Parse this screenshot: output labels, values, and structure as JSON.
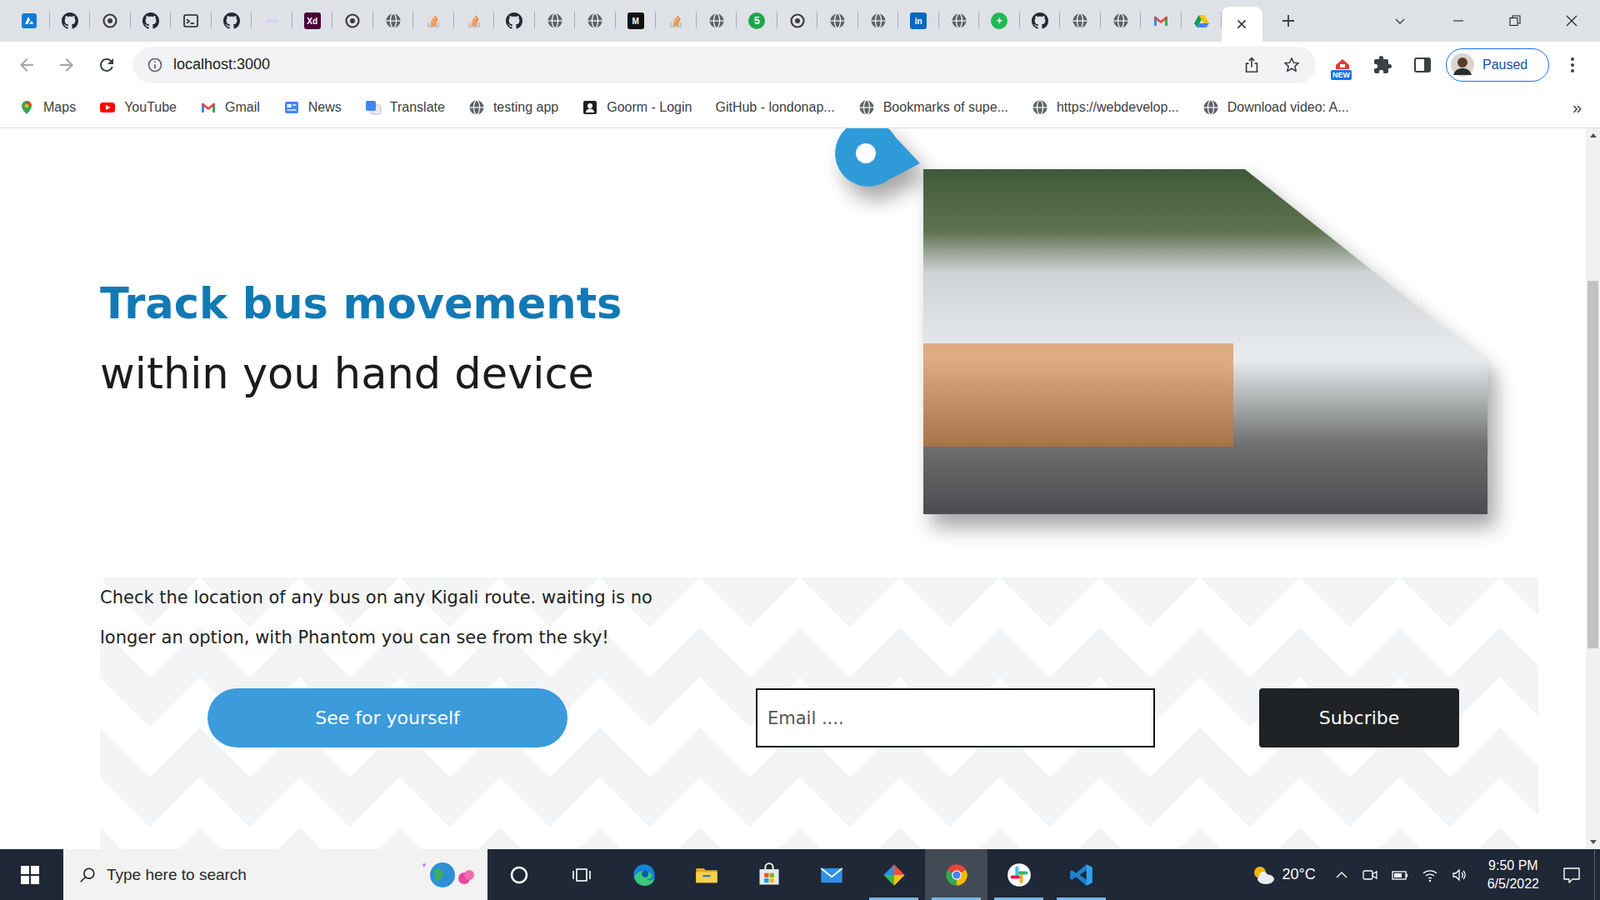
{
  "browser": {
    "tabs": [
      {
        "kind": "azure",
        "selected": false
      },
      {
        "kind": "github",
        "selected": false
      },
      {
        "kind": "chrome",
        "selected": false
      },
      {
        "kind": "github",
        "selected": false
      },
      {
        "kind": "terminal",
        "selected": false
      },
      {
        "kind": "github",
        "selected": false
      },
      {
        "kind": "faint",
        "selected": false
      },
      {
        "kind": "letter",
        "glyph": "Xd",
        "color": "#470137",
        "selected": false
      },
      {
        "kind": "chrome",
        "selected": false
      },
      {
        "kind": "globe",
        "selected": false
      },
      {
        "kind": "stack",
        "selected": false
      },
      {
        "kind": "stack",
        "selected": false
      },
      {
        "kind": "github",
        "selected": false
      },
      {
        "kind": "globe",
        "selected": false
      },
      {
        "kind": "globe",
        "selected": false
      },
      {
        "kind": "letter",
        "glyph": "M",
        "color": "#111111",
        "selected": false
      },
      {
        "kind": "stack",
        "selected": false
      },
      {
        "kind": "globe",
        "selected": false
      },
      {
        "kind": "dot",
        "glyph": "5",
        "color": "#1fa64a",
        "selected": false
      },
      {
        "kind": "chrome",
        "selected": false
      },
      {
        "kind": "globe",
        "selected": false
      },
      {
        "kind": "globe",
        "selected": false
      },
      {
        "kind": "letter",
        "glyph": "in",
        "color": "#0a66c2",
        "selected": false
      },
      {
        "kind": "globe",
        "selected": false
      },
      {
        "kind": "dot",
        "glyph": "+",
        "color": "#1db954",
        "selected": false
      },
      {
        "kind": "github",
        "selected": false
      },
      {
        "kind": "globe",
        "selected": false
      },
      {
        "kind": "globe",
        "selected": false
      },
      {
        "kind": "gmail",
        "selected": false
      },
      {
        "kind": "drive",
        "selected": false
      },
      {
        "kind": "blank",
        "selected": true
      }
    ],
    "address": "localhost:3000",
    "extension_badge": "NEW",
    "profile_status": "Paused",
    "bookmarks": [
      {
        "label": "Maps",
        "kind": "maps"
      },
      {
        "label": "YouTube",
        "kind": "youtube"
      },
      {
        "label": "Gmail",
        "kind": "gmail"
      },
      {
        "label": "News",
        "kind": "news"
      },
      {
        "label": "Translate",
        "kind": "translate"
      },
      {
        "label": "testing app",
        "kind": "globe"
      },
      {
        "label": "Goorm - Login",
        "kind": "goorm"
      },
      {
        "label": "GitHub - londonap...",
        "kind": "none"
      },
      {
        "label": "Bookmarks of supe...",
        "kind": "globe"
      },
      {
        "label": "https://webdevelop...",
        "kind": "globe"
      },
      {
        "label": "Download video: A...",
        "kind": "globe"
      }
    ],
    "more_bookmarks": "»"
  },
  "page": {
    "heading": {
      "highlight": "Track bus movements",
      "rest": "within you hand device"
    },
    "description": "Check the location of any bus on any Kigali route. waiting is no longer an option, with Phantom you can see from the sky!",
    "cta": "See for yourself",
    "email_placeholder": "Email ....",
    "subscribe": "Subcribe",
    "scrollbar": {
      "offset": 0.2,
      "size": 0.53
    }
  },
  "taskbar": {
    "search_placeholder": "Type here to search",
    "apps": [
      {
        "kind": "cortana",
        "running": false,
        "selected": false
      },
      {
        "kind": "taskview",
        "running": false,
        "selected": false
      },
      {
        "kind": "edge",
        "running": false,
        "selected": false
      },
      {
        "kind": "explorer",
        "running": false,
        "selected": false
      },
      {
        "kind": "store",
        "running": false,
        "selected": false
      },
      {
        "kind": "mail",
        "running": false,
        "selected": false
      },
      {
        "kind": "git",
        "running": true,
        "selected": false
      },
      {
        "kind": "chrome",
        "running": true,
        "selected": true
      },
      {
        "kind": "slack",
        "running": true,
        "selected": false
      },
      {
        "kind": "vscode",
        "running": true,
        "selected": false
      }
    ],
    "weather": "20°C",
    "time": "9:50 PM",
    "date": "6/5/2022"
  }
}
